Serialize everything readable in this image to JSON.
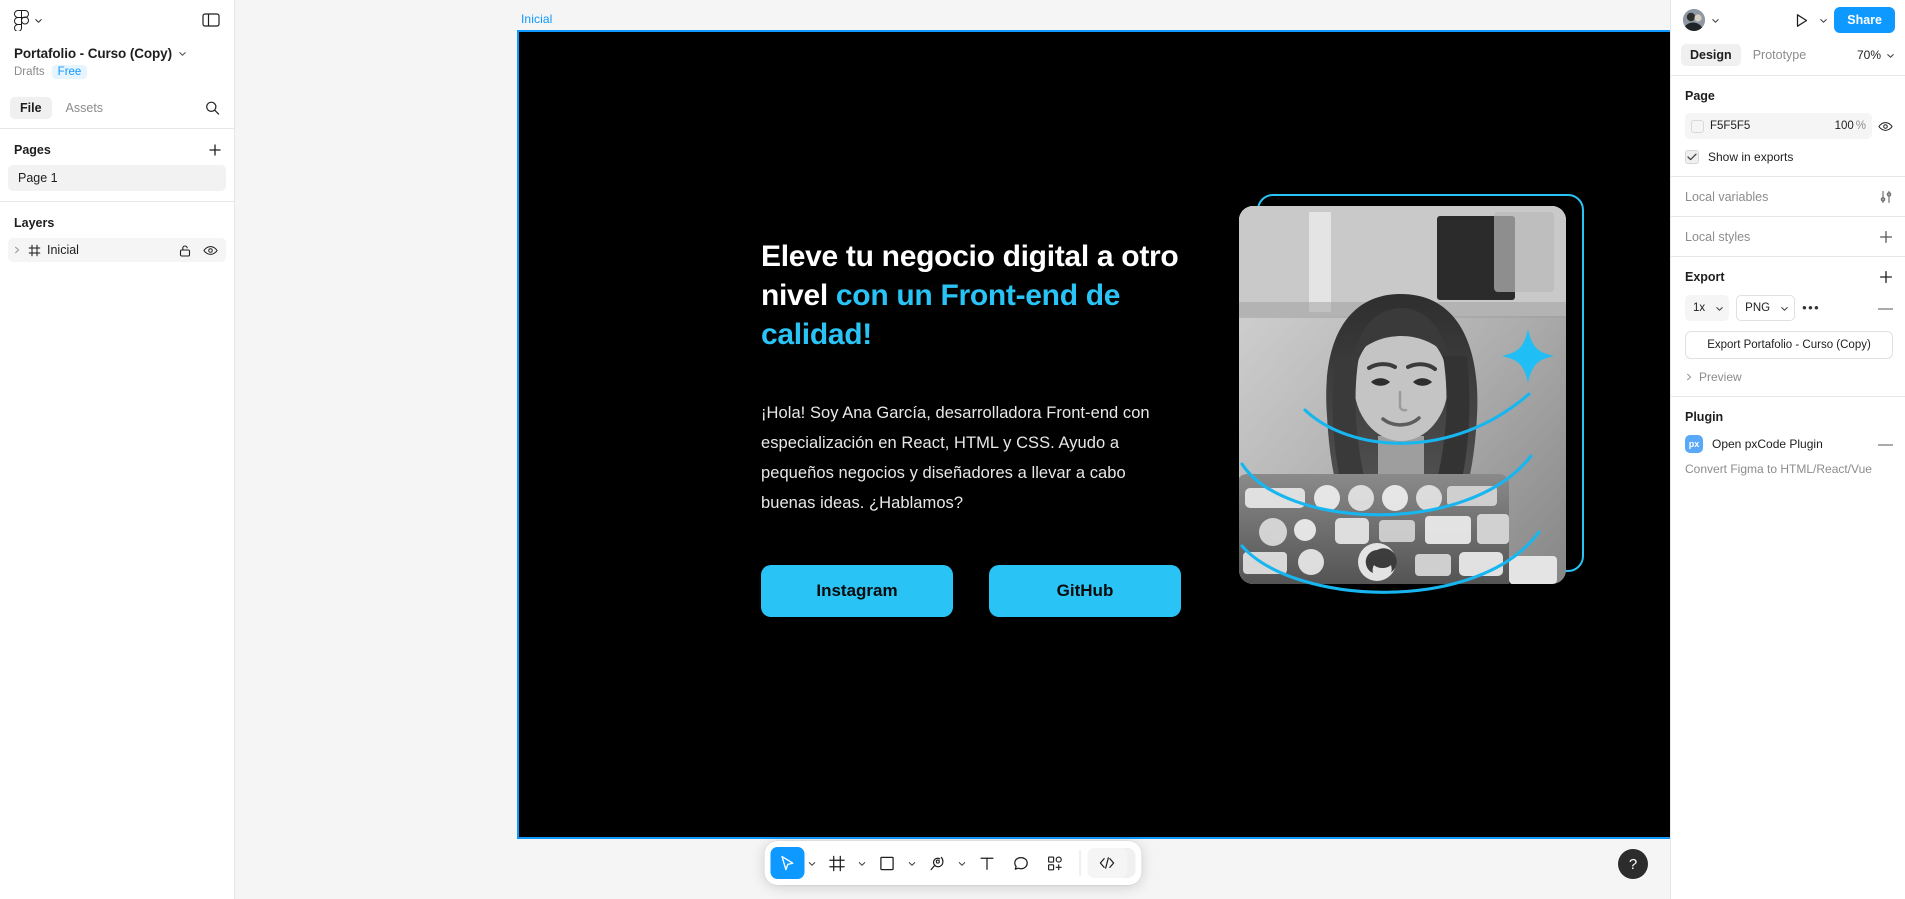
{
  "left_panel": {
    "logo_icon": "figma-logo-icon",
    "file_name": "Portafolio - Curso (Copy)",
    "meta_drafts": "Drafts",
    "meta_plan": "Free",
    "tabs": [
      {
        "label": "File",
        "active": true
      },
      {
        "label": "Assets",
        "active": false
      }
    ],
    "search_icon": "search-icon",
    "pages_title": "Pages",
    "pages": [
      {
        "label": "Page 1",
        "selected": true
      }
    ],
    "layers_title": "Layers",
    "layers": [
      {
        "label": "Inicial",
        "selected": true,
        "locked_icon": "lock-icon",
        "visible_icon": "eye-icon"
      }
    ]
  },
  "canvas": {
    "frame_label": "Inicial",
    "artboard": {
      "background": "#000000",
      "selection_color": "#0d99ff",
      "accent": "#29c4f5",
      "heading_part1": "Eleve tu negocio digital a otro nivel ",
      "heading_accent": "con un Front-end de calidad!",
      "paragraph": "¡Hola! Soy Ana García, desarrolladora Front-end con especialización en React, HTML y CSS. Ayudo a pequeños negocios y diseñadores a llevar a cabo buenas ideas. ¿Hablamos?",
      "buttons": [
        {
          "label": "Instagram"
        },
        {
          "label": "GitHub"
        }
      ],
      "photo_alt": "woman-at-laptop-photo"
    }
  },
  "toolbar": {
    "tools": [
      {
        "name": "move-tool",
        "icon": "cursor-icon",
        "active": true,
        "has_caret": true
      },
      {
        "name": "frame-tool",
        "icon": "frame-icon",
        "active": false,
        "has_caret": true
      },
      {
        "name": "shape-tool",
        "icon": "rectangle-icon",
        "active": false,
        "has_caret": true
      },
      {
        "name": "pen-tool",
        "icon": "pen-icon",
        "active": false,
        "has_caret": true
      },
      {
        "name": "text-tool",
        "icon": "text-icon",
        "active": false,
        "has_caret": false
      },
      {
        "name": "comment-tool",
        "icon": "comment-icon",
        "active": false,
        "has_caret": false
      },
      {
        "name": "actions-tool",
        "icon": "components-icon",
        "active": false,
        "has_caret": false
      }
    ],
    "code_tool": {
      "name": "dev-mode-tool",
      "icon": "code-icon"
    },
    "help_label": "?"
  },
  "right_panel": {
    "avatar_icon": "user-avatar",
    "present_icon": "play-icon",
    "share_label": "Share",
    "tabs": [
      {
        "label": "Design",
        "active": true
      },
      {
        "label": "Prototype",
        "active": false
      }
    ],
    "zoom_level": "70%",
    "page_section": {
      "title": "Page",
      "fill_hex": "F5F5F5",
      "fill_swatch": "#f5f5f5",
      "opacity": "100",
      "opacity_unit": "%",
      "visibility_icon": "eye-icon",
      "show_in_exports": "Show in exports",
      "show_in_exports_checked": true
    },
    "local_variables": {
      "title": "Local variables",
      "icon": "variables-icon"
    },
    "local_styles": {
      "title": "Local styles",
      "icon": "plus-icon"
    },
    "export_section": {
      "title": "Export",
      "add_icon": "plus-icon",
      "scale": "1x",
      "format": "PNG",
      "more_icon": "more-dots-icon",
      "remove_icon": "minus-icon",
      "export_button": "Export Portafolio - Curso (Copy)",
      "preview_label": "Preview"
    },
    "plugin_section": {
      "title": "Plugin",
      "plugin_badge": "px",
      "plugin_name": "Open pxCode Plugin",
      "plugin_desc": "Convert Figma to HTML/React/Vue",
      "remove_icon": "minus-icon"
    }
  }
}
